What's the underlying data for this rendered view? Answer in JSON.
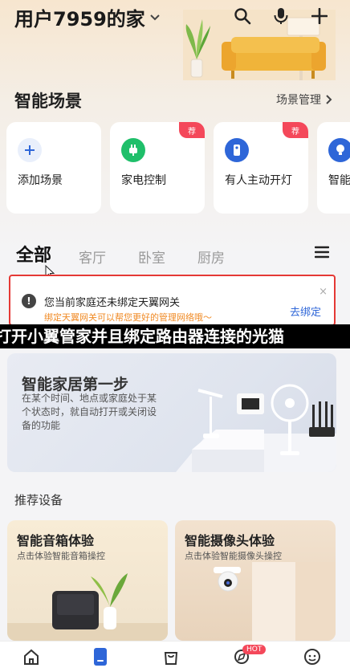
{
  "header": {
    "home_title": "用户7959的家",
    "icons": [
      "search-icon",
      "microphone-icon",
      "plus-icon"
    ]
  },
  "scenes": {
    "title": "智能场景",
    "manage_link": "场景管理",
    "cards": [
      {
        "label": "添加场景",
        "icon": "plus-icon",
        "badge": ""
      },
      {
        "label": "家电控制",
        "icon": "plug-icon",
        "badge": "荐"
      },
      {
        "label": "有人主动开灯",
        "icon": "sensor-icon",
        "badge": "荐"
      },
      {
        "label": "智能",
        "icon": "bulb-icon",
        "badge": ""
      }
    ]
  },
  "rooms": {
    "tabs": [
      "全部",
      "客厅",
      "卧室",
      "厨房"
    ],
    "active": "全部"
  },
  "notice": {
    "title": "您当前家庭还未绑定天翼网关",
    "subtitle": "绑定天翼网关可以帮您更好的管理网络哦～",
    "action": "去绑定",
    "close": "×"
  },
  "caption": "打开小翼管家并且绑定路由器连接的光猫",
  "first_step": {
    "title": "智能家居第一步",
    "description": "在某个时间、地点或家庭处于某个状态时，就自动打开或关闭设备的功能"
  },
  "recommend": {
    "title": "推荐设备",
    "devices": [
      {
        "title": "智能音箱体验",
        "subtitle": "点击体验智能音箱操控"
      },
      {
        "title": "智能摄像头体验",
        "subtitle": "点击体验智能摄像头操控"
      }
    ]
  },
  "tabbar": {
    "items": [
      "home-icon",
      "device-icon",
      "bag-icon",
      "discover-icon",
      "profile-icon"
    ],
    "hot_badge": "HOT"
  },
  "colors": {
    "accent_blue": "#2e66d8",
    "badge_red": "#f4485a",
    "notice_orange": "#f08a24",
    "notice_border": "#e53935"
  }
}
